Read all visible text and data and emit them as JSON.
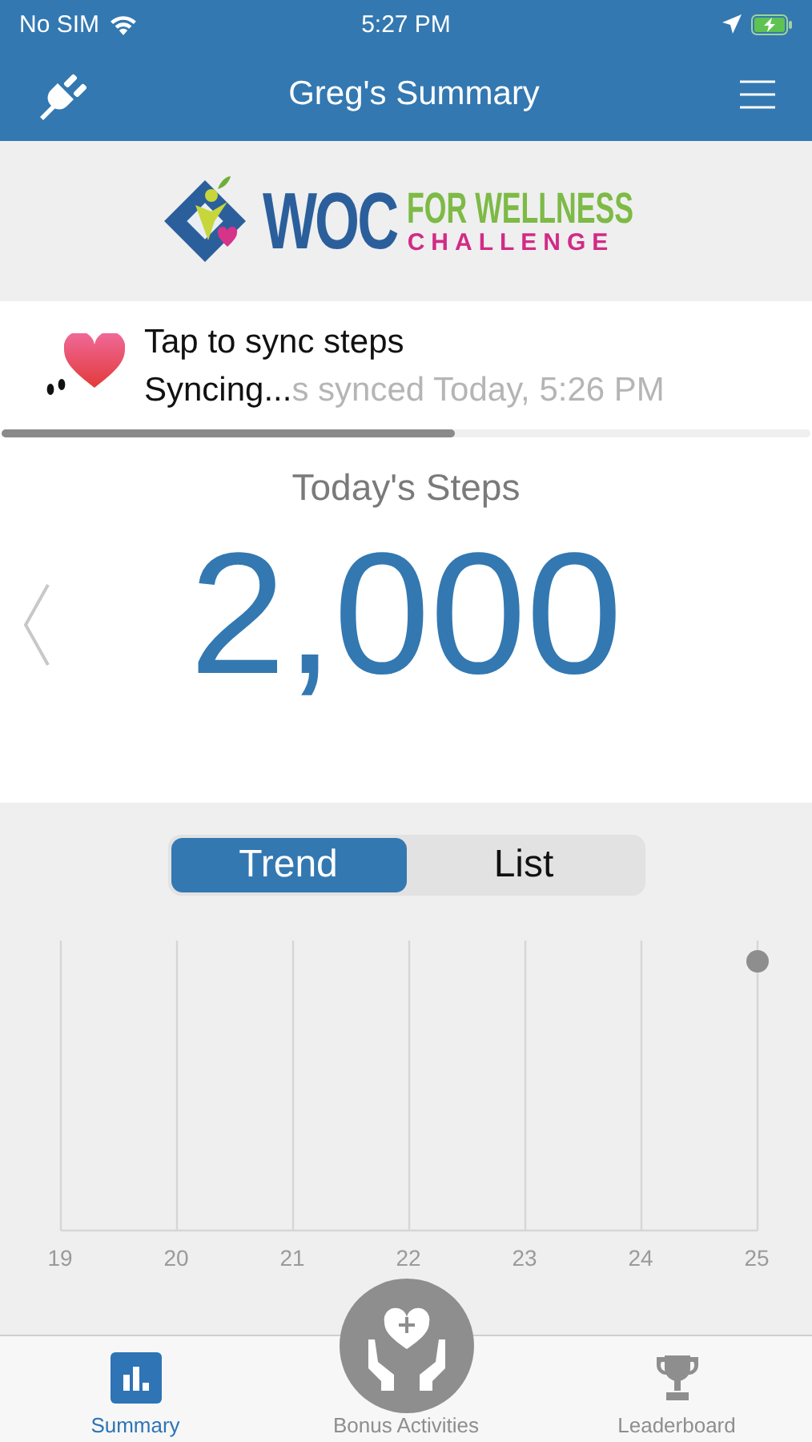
{
  "status_bar": {
    "carrier": "No SIM",
    "time": "5:27 PM"
  },
  "nav": {
    "title": "Greg's Summary"
  },
  "logo": {
    "main": "WOC",
    "line_1": "FOR WELLNESS",
    "line_2": "CHALLENGE"
  },
  "sync": {
    "action": "Tap to sync steps",
    "status": "Syncing...",
    "previous_status": "s synced Today, 5:26 PM",
    "level": 0.56
  },
  "steps": {
    "title": "Today's Steps",
    "value": "2,000"
  },
  "view_toggle": [
    {
      "label": "Trend",
      "selected": true
    },
    {
      "label": "List",
      "selected": false
    }
  ],
  "trend": {
    "day_labels": [
      "19",
      "20",
      "21",
      "22",
      "23",
      "24",
      "25"
    ]
  },
  "tab_bar": [
    {
      "label": "Summary",
      "kind": "summary",
      "selected": true
    },
    {
      "label": "Bonus Activities",
      "kind": "bonus",
      "selected": false
    },
    {
      "label": "Leaderboard",
      "kind": "leaderboard",
      "selected": false
    }
  ]
}
